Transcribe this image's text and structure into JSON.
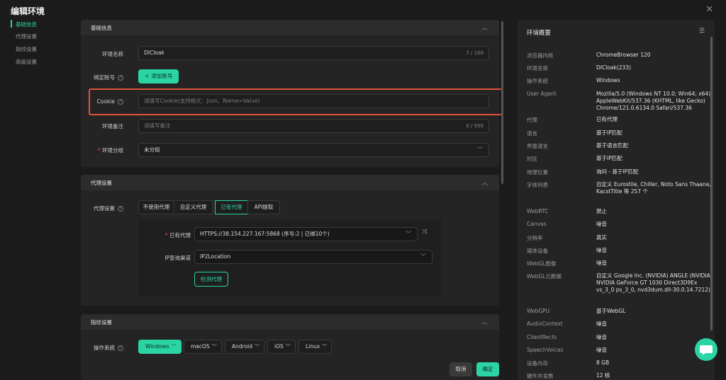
{
  "dialog_title": "编辑环境",
  "sidenav": [
    "基础信息",
    "代理设置",
    "指纹设置",
    "高级设置"
  ],
  "basic": {
    "section_title": "基础信息",
    "env_name_label": "环境名称",
    "env_name_value": "DICloak",
    "env_name_count": "7 / 100",
    "bind_label": "绑定账号",
    "add_account_label": "添加账号",
    "cookie_label": "Cookie",
    "cookie_placeholder": "请填写Cookie(支持格式：Json、Name=Value)",
    "remark_label": "环境备注",
    "remark_placeholder": "请填写备注",
    "remark_count": "0 / 500",
    "group_label": "环境分组",
    "group_value": "未分组"
  },
  "proxy": {
    "section_title": "代理设置",
    "setting_label": "代理设置",
    "tabs": [
      "不使用代理",
      "自定义代理",
      "已有代理",
      "API提取"
    ],
    "existing_label": "已有代理",
    "existing_value": "HTTPS://38.154.227.167:5868 (序号:2 | 已绑10个)",
    "ip_channel_label": "IP查询渠道",
    "ip_channel_value": "IP2Location",
    "check_button": "检测代理"
  },
  "fingerprint": {
    "section_title": "指纹设置",
    "os_label": "操作系统",
    "os_options": [
      "Windows",
      "macOS",
      "Android",
      "iOS",
      "Linux"
    ]
  },
  "footer": {
    "cancel": "取消",
    "confirm": "确定"
  },
  "summary": {
    "title": "环境概要",
    "rows": [
      {
        "k": "浏览器内核",
        "v": "ChromeBrowser 120"
      },
      {
        "k": "环境名称",
        "v": "DICloak(233)"
      },
      {
        "k": "操作系统",
        "v": "Windows"
      },
      {
        "k": "User Agent",
        "v": "Mozilla/5.0 (Windows NT 10.0; Win64; x64) AppleWebKit/537.36 (KHTML, like Gecko) Chrome/121.0.6134.0 Safari/537.36"
      },
      {
        "k": "代理",
        "v": "已有代理"
      },
      {
        "k": "语言",
        "v": "基于IP匹配"
      },
      {
        "k": "界面语言",
        "v": "基于语言匹配"
      },
      {
        "k": "时区",
        "v": "基于IP匹配"
      },
      {
        "k": "地理位置",
        "v": "询问 - 基于IP匹配"
      },
      {
        "k": "字体列表",
        "v": "自定义 Eurostile, Chiller, Noto Sans Thaana, KacstTitle 等 257 个"
      },
      {
        "k": "WebRTC",
        "v": "禁止"
      },
      {
        "k": "Canvas",
        "v": "噪音"
      },
      {
        "k": "分辨率",
        "v": "真实"
      },
      {
        "k": "媒体设备",
        "v": "噪音"
      },
      {
        "k": "WebGL图像",
        "v": "噪音"
      },
      {
        "k": "WebGL元数据",
        "v": "自定义 Google Inc. (NVIDIA) ANGLE (NVIDIA, NVIDIA GeForce GT 1030 Direct3D9Ex vs_3_0 ps_3_0, nvd3dum.dll-30.0.14.7212)"
      },
      {
        "k": "WebGPU",
        "v": "基于WebGL"
      },
      {
        "k": "AudioContext",
        "v": "噪音"
      },
      {
        "k": "ClientRects",
        "v": "噪音"
      },
      {
        "k": "SpeechVoices",
        "v": "噪音"
      },
      {
        "k": "设备内存",
        "v": "8 GB"
      },
      {
        "k": "硬件并发数",
        "v": "12 核"
      }
    ]
  },
  "colors": {
    "accent": "#2bd4a4",
    "highlight": "#e0523a",
    "bg": "#1b1b1b",
    "panel": "#242424"
  }
}
